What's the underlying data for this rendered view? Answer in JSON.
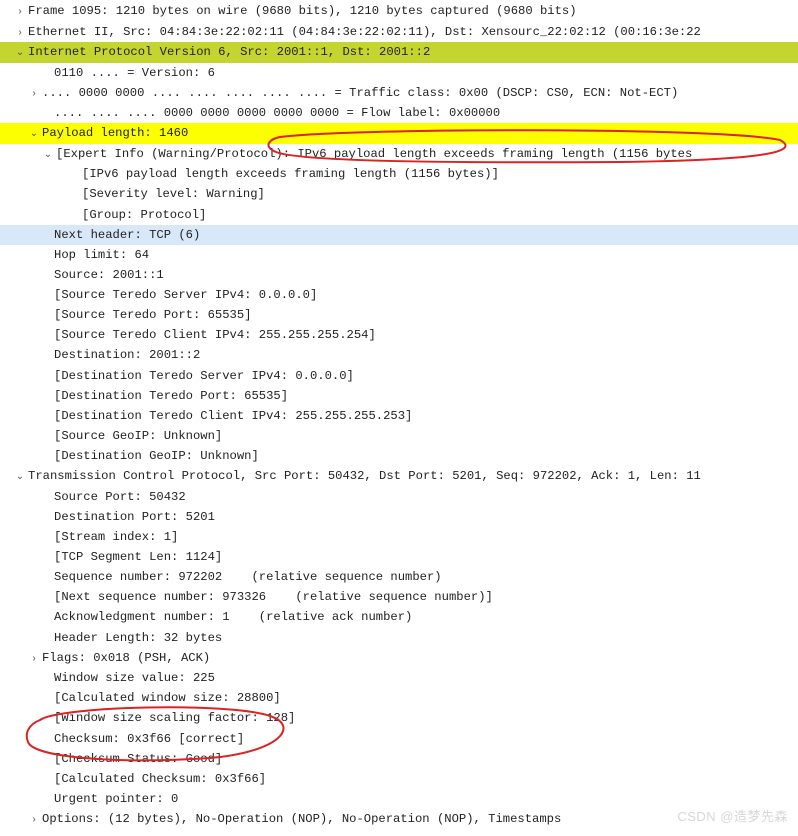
{
  "frame": {
    "summary": "Frame 1095: 1210 bytes on wire (9680 bits), 1210 bytes captured (9680 bits)"
  },
  "eth": {
    "summary": "Ethernet II, Src: 04:84:3e:22:02:11 (04:84:3e:22:02:11), Dst: Xensourc_22:02:12 (00:16:3e:22"
  },
  "ipv6": {
    "summary": "Internet Protocol Version 6, Src: 2001::1, Dst: 2001::2",
    "version": "0110 .... = Version: 6",
    "tclass": ".... 0000 0000 .... .... .... .... .... = Traffic class: 0x00 (DSCP: CS0, ECN: Not-ECT)",
    "flow": ".... .... .... 0000 0000 0000 0000 0000 = Flow label: 0x00000",
    "paylen": "Payload length: 1460",
    "expert": {
      "line": "[Expert Info (Warning/Protocol): IPv6 payload length exceeds framing length (1156 bytes",
      "msg": "[IPv6 payload length exceeds framing length (1156 bytes)]",
      "sev": "[Severity level: Warning]",
      "grp": "[Group: Protocol]"
    },
    "nexthdr": "Next header: TCP (6)",
    "hop": "Hop limit: 64",
    "src": "Source: 2001::1",
    "src_tsrv": "[Source Teredo Server IPv4: 0.0.0.0]",
    "src_tprt": "[Source Teredo Port: 65535]",
    "src_tcli": "[Source Teredo Client IPv4: 255.255.255.254]",
    "dst": "Destination: 2001::2",
    "dst_tsrv": "[Destination Teredo Server IPv4: 0.0.0.0]",
    "dst_tprt": "[Destination Teredo Port: 65535]",
    "dst_tcli": "[Destination Teredo Client IPv4: 255.255.255.253]",
    "sgeo": "[Source GeoIP: Unknown]",
    "dgeo": "[Destination GeoIP: Unknown]"
  },
  "tcp": {
    "summary": "Transmission Control Protocol, Src Port: 50432, Dst Port: 5201, Seq: 972202, Ack: 1, Len: 11",
    "srcport": "Source Port: 50432",
    "dstport": "Destination Port: 5201",
    "stream": "[Stream index: 1]",
    "seglen": "[TCP Segment Len: 1124]",
    "seq": "Sequence number: 972202    (relative sequence number)",
    "nxtseq": "[Next sequence number: 973326    (relative sequence number)]",
    "ack": "Acknowledgment number: 1    (relative ack number)",
    "hlen": "Header Length: 32 bytes",
    "flags": "Flags: 0x018 (PSH, ACK)",
    "win": "Window size value: 225",
    "cwin": "[Calculated window size: 28800]",
    "wscale": "[Window size scaling factor: 128]",
    "chksum": "Checksum: 0x3f66 [correct]",
    "chkstat": "[Checksum Status: Good]",
    "cchksum": "[Calculated Checksum: 0x3f66]",
    "urg": "Urgent pointer: 0",
    "opts": "Options: (12 bytes), No-Operation (NOP), No-Operation (NOP), Timestamps"
  },
  "watermark": "CSDN @造梦先森",
  "glyph": {
    "closed": "›",
    "open": "⌄"
  }
}
